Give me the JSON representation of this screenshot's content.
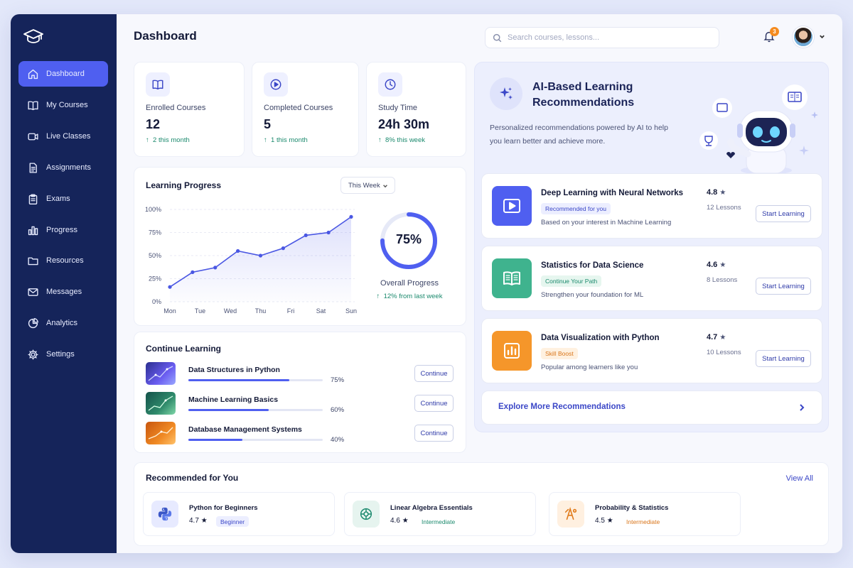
{
  "header": {
    "title": "Dashboard",
    "search_placeholder": "Search courses, lessons...",
    "notification_count": "3"
  },
  "sidebar": {
    "items": [
      {
        "label": "Dashboard",
        "icon": "home-icon",
        "active": true
      },
      {
        "label": "My Courses",
        "icon": "book-icon"
      },
      {
        "label": "Live Classes",
        "icon": "video-icon"
      },
      {
        "label": "Assignments",
        "icon": "assignment-icon"
      },
      {
        "label": "Exams",
        "icon": "clipboard-icon"
      },
      {
        "label": "Progress",
        "icon": "bar-chart-icon"
      },
      {
        "label": "Resources",
        "icon": "folder-icon"
      },
      {
        "label": "Messages",
        "icon": "mail-icon"
      },
      {
        "label": "Analytics",
        "icon": "pie-chart-icon"
      },
      {
        "label": "Settings",
        "icon": "gear-icon"
      }
    ]
  },
  "stats": [
    {
      "label": "Enrolled Courses",
      "value": "12",
      "trend": "2 this month",
      "icon": "book-icon"
    },
    {
      "label": "Completed Courses",
      "value": "5",
      "trend": "1 this month",
      "icon": "play-circle-icon"
    },
    {
      "label": "Study Time",
      "value": "24h 30m",
      "trend": "8% this week",
      "icon": "clock-icon"
    }
  ],
  "learning_progress": {
    "title": "Learning Progress",
    "period": "This Week",
    "overall_value": "75%",
    "overall_percent": 75,
    "overall_label": "Overall Progress",
    "overall_trend": "12% from last week"
  },
  "chart_data": {
    "type": "area",
    "categories": [
      "Mon",
      "Tue",
      "Wed",
      "Thu",
      "Fri",
      "Sat",
      "Sun"
    ],
    "ytick_labels": [
      "0%",
      "25%",
      "50%",
      "75%",
      "100%"
    ],
    "x": [
      0,
      0.75,
      1.5,
      2.25,
      3,
      3.75,
      4.5,
      5.25,
      6
    ],
    "values": [
      16,
      32,
      37,
      55,
      50,
      58,
      72,
      75,
      92
    ],
    "ylim": [
      0,
      100
    ],
    "grid": true,
    "color": "#4a57e3"
  },
  "continue_learning": {
    "title": "Continue Learning",
    "items": [
      {
        "name": "Data Structures in Python",
        "progress": "75%",
        "percent": 75,
        "button": "Continue"
      },
      {
        "name": "Machine Learning Basics",
        "progress": "60%",
        "percent": 60,
        "button": "Continue"
      },
      {
        "name": "Database Management Systems",
        "progress": "40%",
        "percent": 40,
        "button": "Continue"
      }
    ]
  },
  "ai": {
    "title": "AI-Based Learning Recommendations",
    "description": "Personalized recommendations powered by AI to help you learn better and achieve more.",
    "cards": [
      {
        "name": "Deep Learning with Neural Networks",
        "tag": "Recommended for you",
        "sub": "Based on your interest in Machine Learning",
        "rating": "4.8",
        "lessons": "12 Lessons",
        "button": "Start Learning",
        "color": "#4f5ff0",
        "tag_bg": "#eceeff",
        "tag_color": "#3b47c7",
        "icon": "play-icon"
      },
      {
        "name": "Statistics for Data Science",
        "tag": "Continue Your Path",
        "sub": "Strengthen your foundation for ML",
        "rating": "4.6",
        "lessons": "8 Lessons",
        "button": "Start Learning",
        "color": "#3fb38e",
        "tag_bg": "#e6f6ef",
        "tag_color": "#1c8a6e",
        "icon": "open-book-icon"
      },
      {
        "name": "Data Visualization with Python",
        "tag": "Skill Boost",
        "sub": "Popular among learners like you",
        "rating": "4.7",
        "lessons": "10 Lessons",
        "button": "Start Learning",
        "color": "#f5962a",
        "tag_bg": "#fff1e0",
        "tag_color": "#d9751a",
        "icon": "chart-board-icon"
      }
    ],
    "explore": "Explore More Recommendations"
  },
  "recommended": {
    "title": "Recommended for You",
    "view_all": "View All",
    "items": [
      {
        "name": "Python for Beginners",
        "rating": "4.7",
        "level": "Beginner",
        "icon": "python-icon",
        "bg": "#e7eaff",
        "level_bg": "#eceeff",
        "level_color": "#3b47c7"
      },
      {
        "name": "Linear Algebra Essentials",
        "rating": "4.6",
        "level": "Intermediate",
        "icon": "matrix-icon",
        "bg": "#e6f4ef",
        "level_bg": "#ffffff",
        "level_color": "#1c8a6e"
      },
      {
        "name": "Probability & Statistics",
        "rating": "4.5",
        "level": "Intermediate",
        "icon": "probability-icon",
        "bg": "#fff0e0",
        "level_bg": "#ffffff",
        "level_color": "#d9751a"
      }
    ]
  },
  "colors": {
    "sidebar": "#15245a",
    "accent": "#4f5ff0",
    "success": "#1c8a6e"
  }
}
